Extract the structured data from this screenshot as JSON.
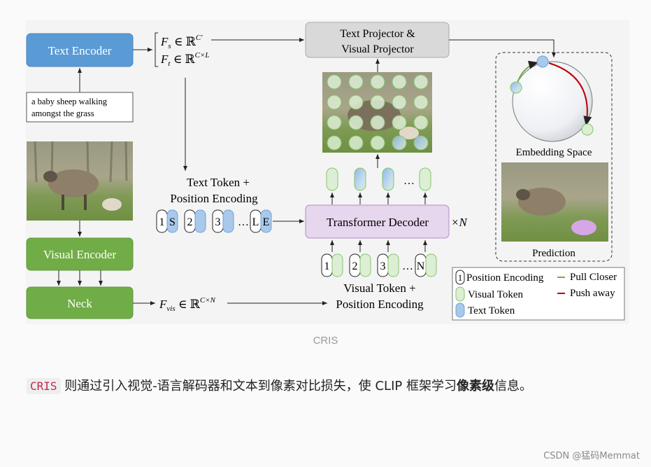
{
  "figure": {
    "text_encoder": "Text Encoder",
    "caption_text_line1": "a baby sheep walking",
    "caption_text_line2": "amongst the grass",
    "visual_encoder": "Visual Encoder",
    "neck": "Neck",
    "fs": "F",
    "fs_sub": "s",
    "fs_set": " ∈ ℝ",
    "fs_sup": "C′",
    "ft": "F",
    "ft_sub": "t",
    "ft_set": " ∈ ℝ",
    "ft_sup": "C×L",
    "fvis": "F",
    "fvis_sub": "vis",
    "fvis_set": " ∈ ℝ",
    "fvis_sup": "C×N",
    "projector_line1": "Text Projector &",
    "projector_line2": "Visual Projector",
    "text_token_label_line1": "Text Token +",
    "text_token_label_line2": "Position Encoding",
    "text_tokens": [
      {
        "pos": "1",
        "tok": "S"
      },
      {
        "pos": "2",
        "tok": ""
      },
      {
        "pos": "3",
        "tok": ""
      },
      {
        "pos": "L",
        "tok": "E"
      }
    ],
    "ellipsis": "…",
    "transformer_decoder": "Transformer Decoder",
    "times_n": "×N",
    "visual_tokens": [
      "1",
      "2",
      "3",
      "N"
    ],
    "visual_token_label_line1": "Visual Token +",
    "visual_token_label_line2": "Position Encoding",
    "embedding_space": "Embedding Space",
    "prediction": "Prediction",
    "legend": {
      "position_encoding_mark": "1",
      "position_encoding": "Position Encoding",
      "visual_token": "Visual Token",
      "text_token": "Text Token",
      "pull_closer": "Pull Closer",
      "push_away": "Push away"
    },
    "colors": {
      "text_encoder": "#5b9bd5",
      "visual_encoder": "#70ad47",
      "projector": "#d9d9d9",
      "decoder": "#e6d6ee",
      "visual_token": "#dcefd4",
      "text_token": "#a9c9ea",
      "pull": "#70ad47",
      "push": "#c00000"
    }
  },
  "caption": "CRIS",
  "paragraph": {
    "code": "CRIS",
    "text1": " 则通过引入视觉-语言解码器和文本到像素对比损失，使 CLIP 框架学习",
    "bold": "像素级",
    "text2": "信息。"
  },
  "watermark": "CSDN @猛码Memmat"
}
